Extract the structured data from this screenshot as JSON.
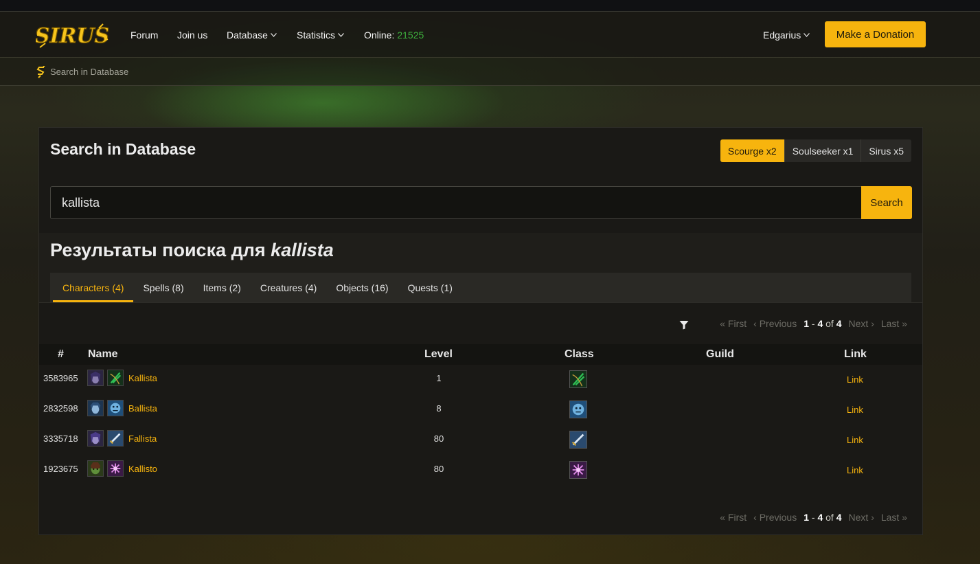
{
  "navbar": {
    "logo_text": "SIRUS",
    "forum": "Forum",
    "join": "Join us",
    "database": "Database",
    "statistics": "Statistics",
    "online_label": "Online:",
    "online_count": "21525",
    "user": "Edgarius",
    "donate": "Make a Donation"
  },
  "breadcrumb": {
    "label": "Search in Database"
  },
  "panel": {
    "title": "Search in Database",
    "realms": [
      "Scourge x2",
      "Soulseeker x1",
      "Sirus x5"
    ],
    "active_realm": "Scourge x2",
    "search_value": "kallista",
    "search_button": "Search"
  },
  "results": {
    "heading_prefix": "Результаты поиска для",
    "heading_query": "kallista",
    "tabs": [
      "Characters (4)",
      "Spells (8)",
      "Items (2)",
      "Creatures (4)",
      "Objects (16)",
      "Quests (1)"
    ],
    "active_tab": "Characters (4)"
  },
  "pager": {
    "first": "« First",
    "previous": "‹ Previous",
    "range_start": "1",
    "range_sep": " - ",
    "range_end": "4",
    "range_of": " of ",
    "range_total": "4",
    "next": "Next ›",
    "last": "Last »"
  },
  "table": {
    "headers": {
      "num": "#",
      "name": "Name",
      "level": "Level",
      "class": "Class",
      "guild": "Guild",
      "link": "Link"
    },
    "rows": [
      {
        "id": "3583965",
        "name": "Kallista",
        "level": "1",
        "guild": "",
        "link": "Link",
        "race_icon": "night-elf-female-portrait-icon",
        "class_icon": "hunter-class-icon"
      },
      {
        "id": "2832598",
        "name": "Ballista",
        "level": "8",
        "guild": "",
        "link": "Link",
        "race_icon": "draenei-female-portrait-icon",
        "class_icon": "shaman-class-icon"
      },
      {
        "id": "3335718",
        "name": "Fallista",
        "level": "80",
        "guild": "",
        "link": "Link",
        "race_icon": "night-elf-female-portrait-icon",
        "class_icon": "warrior-class-icon"
      },
      {
        "id": "1923675",
        "name": "Kallisto",
        "level": "80",
        "guild": "",
        "link": "Link",
        "race_icon": "orc-female-portrait-icon",
        "class_icon": "warlock-class-icon"
      }
    ]
  },
  "colors": {
    "accent": "#f7b40e",
    "online_green": "#3db03d",
    "panel_bg": "#1a1916",
    "page_bg": "#232118"
  }
}
